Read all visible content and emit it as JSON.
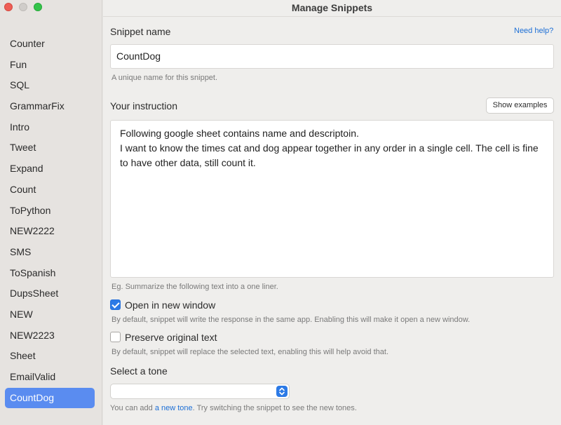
{
  "window": {
    "title": "Manage Snippets"
  },
  "sidebar": {
    "items": [
      {
        "label": "Counter",
        "active": false
      },
      {
        "label": "Fun",
        "active": false
      },
      {
        "label": "SQL",
        "active": false
      },
      {
        "label": "GrammarFix",
        "active": false
      },
      {
        "label": "Intro",
        "active": false
      },
      {
        "label": "Tweet",
        "active": false
      },
      {
        "label": "Expand",
        "active": false
      },
      {
        "label": "Count",
        "active": false
      },
      {
        "label": "ToPython",
        "active": false
      },
      {
        "label": "NEW2222",
        "active": false
      },
      {
        "label": "SMS",
        "active": false
      },
      {
        "label": "ToSpanish",
        "active": false
      },
      {
        "label": "DupsSheet",
        "active": false
      },
      {
        "label": "NEW",
        "active": false
      },
      {
        "label": "NEW2223",
        "active": false
      },
      {
        "label": "Sheet",
        "active": false
      },
      {
        "label": "EmailValid",
        "active": false
      },
      {
        "label": "CountDog",
        "active": true
      }
    ]
  },
  "form": {
    "name_label": "Snippet name",
    "need_help": "Need help?",
    "name_value": "CountDog",
    "name_hint": "A unique name for this snippet.",
    "instruction_label": "Your instruction",
    "show_examples": "Show examples",
    "instruction_value": "Following google sheet contains name and descriptoin.\nI want to know the times cat and dog appear together in any order in a single cell. The cell is fine to have other data, still count it.",
    "instruction_hint": "Eg. Summarize the following text into a one liner.",
    "open_new_window_label": "Open in new window",
    "open_new_window_checked": true,
    "open_new_window_hint": "By default, snippet will write the response in the same app. Enabling this will make it open a new window.",
    "preserve_label": "Preserve original text",
    "preserve_checked": false,
    "preserve_hint": "By default, snippet will replace the selected text, enabling this will help avoid that.",
    "tone_label": "Select a tone",
    "tone_value": "",
    "tone_hint_pre": "You can add ",
    "tone_hint_link": "a new tone",
    "tone_hint_post": ". Try switching the snippet to see the new tones."
  },
  "colors": {
    "accent": "#2c7ae6",
    "sidebar_selected": "#5a8cf0",
    "link": "#1d6fd6"
  }
}
